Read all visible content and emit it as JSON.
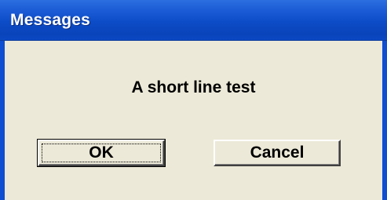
{
  "window": {
    "title": "Messages"
  },
  "dialog": {
    "message": "A short line test",
    "ok_label": "OK",
    "cancel_label": "Cancel"
  },
  "colors": {
    "titlebar": "#0c4cc6",
    "background": "#ece9d8",
    "border": "#0e4ed0"
  }
}
